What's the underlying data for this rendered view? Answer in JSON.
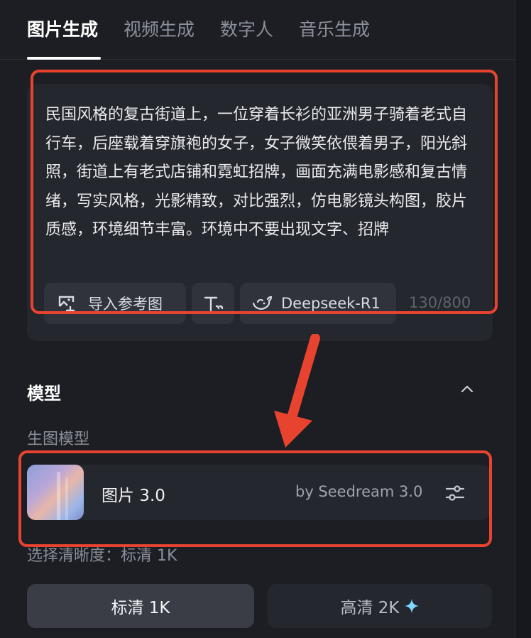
{
  "tabs": [
    {
      "label": "图片生成",
      "active": true
    },
    {
      "label": "视频生成",
      "active": false
    },
    {
      "label": "数字人",
      "active": false
    },
    {
      "label": "音乐生成",
      "active": false
    }
  ],
  "prompt": {
    "text": "民国风格的复古街道上，一位穿着长衫的亚洲男子骑着老式自行车，后座载着穿旗袍的女子，女子微笑依偎着男子，阳光斜照，街道上有老式店铺和霓虹招牌，画面充满电影感和复古情绪，写实风格，光影精致，对比强烈，仿电影镜头构图，胶片质感，环境细节丰富。环境中不要出现文字、招牌",
    "import_ref_label": "导入参考图",
    "deepseek_label": "Deepseek-R1",
    "counter": "130/800"
  },
  "model_section": {
    "title": "模型",
    "sub_label": "生图模型",
    "model": {
      "name": "图片 3.0",
      "by": "by Seedream 3.0"
    }
  },
  "resolution": {
    "label": "选择清晰度：标清 1K",
    "options": [
      {
        "label": "标清 1K",
        "selected": true
      },
      {
        "label": "高清 2K",
        "selected": false
      }
    ]
  },
  "colors": {
    "annotation_red": "#e8432f",
    "background": "#1c1e24",
    "card": "#25272e",
    "sparkle": "#7fd8ff"
  },
  "icons": [
    "image-import-icon",
    "text-format-icon",
    "deepseek-whale-icon",
    "chevron-up-icon",
    "sliders-icon",
    "sparkle-icon"
  ]
}
